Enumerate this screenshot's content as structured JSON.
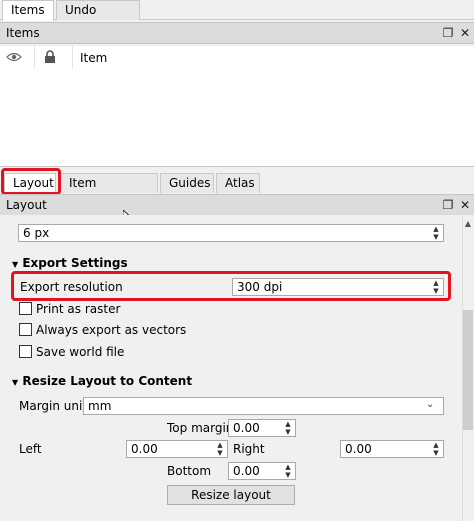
{
  "top_tabs": [
    "Items",
    "Undo History"
  ],
  "items_panel": {
    "title": "Items",
    "column_item": "Item",
    "float_icon": "restore-icon",
    "close_icon": "close-icon",
    "close_glyph": "✕",
    "float_glyph": "❐"
  },
  "bottom_tabs": [
    "Layout",
    "Item Properties",
    "Guides",
    "Atlas"
  ],
  "layout_panel": {
    "title": "Layout",
    "top_value": "6 px",
    "export_settings": {
      "title": "Export Settings",
      "resolution_label": "Export resolution",
      "resolution_value": "300 dpi",
      "print_as_raster": "Print as raster",
      "always_vectors": "Always export as vectors",
      "save_world_file": "Save world file"
    },
    "resize": {
      "title": "Resize Layout to Content",
      "margin_units_label": "Margin units",
      "margin_units_value": "mm",
      "top_margin_label": "Top margin",
      "top_margin_value": "0.00",
      "left_label": "Left",
      "left_value": "0.00",
      "right_label": "Right",
      "right_value": "0.00",
      "bottom_label": "Bottom",
      "bottom_value": "0.00",
      "button": "Resize layout"
    }
  },
  "colors": {
    "highlight": "#e2141f"
  }
}
